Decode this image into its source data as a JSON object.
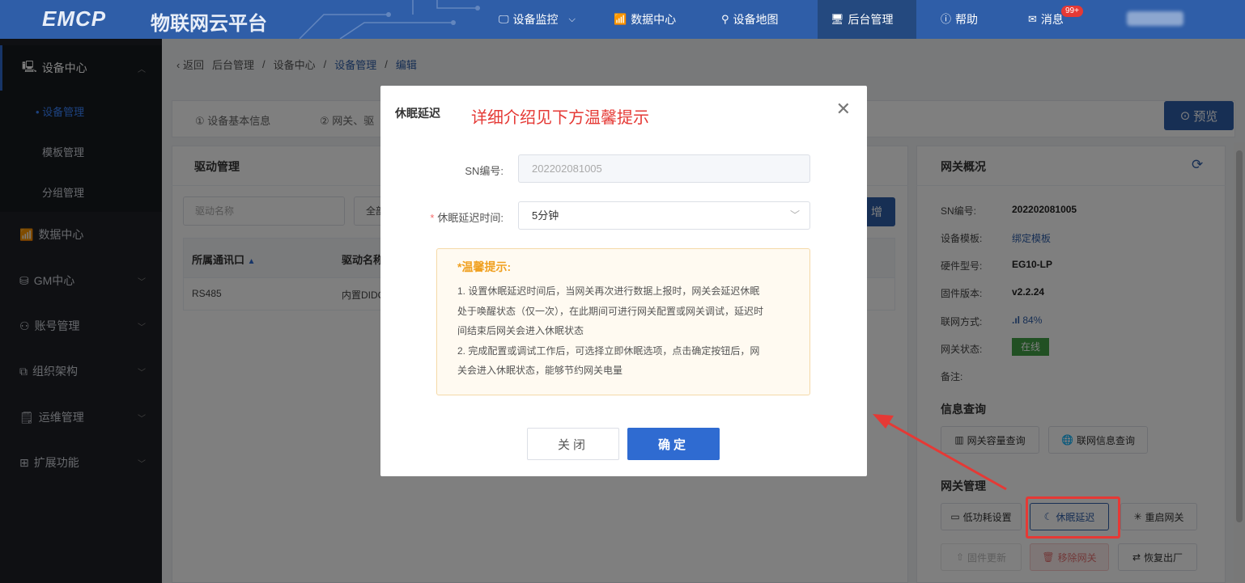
{
  "header": {
    "logo": "EMCP",
    "platform": "物联网云平台",
    "nav": [
      {
        "label": "设备监控",
        "icon": "monitor-icon",
        "chevron": "⌵"
      },
      {
        "label": "数据中心",
        "icon": "chart-icon"
      },
      {
        "label": "设备地图",
        "icon": "map-pin-icon"
      },
      {
        "label": "后台管理",
        "icon": "admin-icon",
        "active": true
      },
      {
        "label": "帮助",
        "icon": "help-icon"
      },
      {
        "label": "消息",
        "icon": "message-icon"
      }
    ],
    "message_badge": "99+"
  },
  "sidebar": {
    "top": {
      "label": "设备中心"
    },
    "subs": [
      {
        "label": "• 设备管理"
      },
      {
        "label": "模板管理"
      },
      {
        "label": "分组管理"
      }
    ],
    "groups": [
      {
        "label": "数据中心"
      },
      {
        "label": "GM中心"
      },
      {
        "label": "账号管理"
      },
      {
        "label": "组织架构"
      },
      {
        "label": "运维管理"
      },
      {
        "label": "扩展功能"
      }
    ]
  },
  "breadcrumb": {
    "back": "返回",
    "items": [
      "后台管理",
      "/",
      "设备中心",
      "/",
      "设备管理",
      "/",
      "编辑"
    ]
  },
  "steps": [
    "① 设备基本信息",
    "② 网关、驱"
  ],
  "preview_label": "预览",
  "driver_panel": {
    "title": "驱动管理",
    "search_placeholder": "驱动名称",
    "filter_text": "全部",
    "new_label": "增",
    "columns": [
      "所属通讯口",
      "驱动名称"
    ],
    "rows": [
      [
        "RS485",
        "内置DIDO"
      ]
    ]
  },
  "gateway": {
    "title": "网关概况",
    "fields": [
      {
        "k": "SN编号:",
        "v": "202202081005"
      },
      {
        "k": "设备模板:",
        "v": "绑定模板"
      },
      {
        "k": "硬件型号:",
        "v": "EG10-LP"
      },
      {
        "k": "固件版本:",
        "v": "v2.2.24"
      },
      {
        "k": "联网方式:",
        "v": "84%"
      },
      {
        "k": "网关状态:",
        "v": "在线"
      },
      {
        "k": "备注:",
        "v": ""
      }
    ],
    "info_title": "信息查询",
    "info_buttons": [
      "网关容量查询",
      "联网信息查询"
    ],
    "manage_title": "网关管理",
    "manage_buttons": [
      "低功耗设置",
      "休眠延迟",
      "重启网关",
      "固件更新",
      "移除网关",
      "恢复出厂"
    ],
    "status_color": "#43a047"
  },
  "modal": {
    "title": "休眠延迟",
    "annotation": "详细介绍见下方温馨提示",
    "sn_label": "SN编号:",
    "sn_value": "202202081005",
    "delay_label": "休眠延迟时间:",
    "delay_value": "5分钟",
    "tip_title": "*温馨提示:",
    "tip_lines": [
      "1. 设置休眠延迟时间后，当网关再次进行数据上报时，网关会延迟休眠",
      "处于唤醒状态（仅一次），在此期间可进行网关配置或网关调试，延迟时",
      "间结束后网关会进入休眠状态",
      "2. 完成配置或调试工作后，可选择立即休眠选项，点击确定按钮后，网",
      "关会进入休眠状态，能够节约网关电量"
    ],
    "cancel_label": "关闭",
    "ok_label": "确定"
  },
  "colors": {
    "brand": "#2f5ea8",
    "accent": "#2f6bd1",
    "annotation": "#e53935",
    "sidebar": "#1f2126"
  }
}
